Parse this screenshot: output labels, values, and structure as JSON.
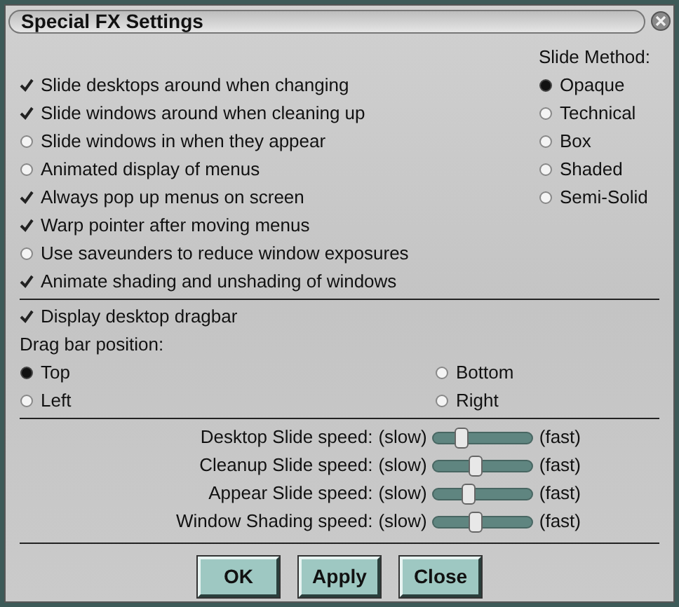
{
  "window": {
    "title": "Special FX Settings"
  },
  "options": [
    {
      "label": "Slide desktops around when changing",
      "checked": true
    },
    {
      "label": "Slide windows around when cleaning up",
      "checked": true
    },
    {
      "label": "Slide windows in when they appear",
      "checked": false
    },
    {
      "label": "Animated display of menus",
      "checked": false
    },
    {
      "label": "Always pop up menus on screen",
      "checked": true
    },
    {
      "label": "Warp pointer after moving menus",
      "checked": true
    },
    {
      "label": "Use saveunders to reduce window exposures",
      "checked": false
    },
    {
      "label": "Animate shading and unshading of windows",
      "checked": true
    }
  ],
  "slide_method": {
    "label": "Slide Method:",
    "choices": [
      {
        "label": "Opaque",
        "selected": true
      },
      {
        "label": "Technical",
        "selected": false
      },
      {
        "label": "Box",
        "selected": false
      },
      {
        "label": "Shaded",
        "selected": false
      },
      {
        "label": "Semi-Solid",
        "selected": false
      }
    ]
  },
  "dragbar": {
    "display": {
      "label": "Display desktop dragbar",
      "checked": true
    },
    "position_label": "Drag bar position:",
    "positions": [
      {
        "label": "Top",
        "selected": true
      },
      {
        "label": "Bottom",
        "selected": false
      },
      {
        "label": "Left",
        "selected": false
      },
      {
        "label": "Right",
        "selected": false
      }
    ]
  },
  "speeds": [
    {
      "label": "Desktop Slide speed:",
      "slow": "(slow)",
      "fast": "(fast)",
      "level": 0.28
    },
    {
      "label": "Cleanup Slide speed:",
      "slow": "(slow)",
      "fast": "(fast)",
      "level": 0.43
    },
    {
      "label": "Appear Slide speed:",
      "slow": "(slow)",
      "fast": "(fast)",
      "level": 0.35
    },
    {
      "label": "Window Shading speed:",
      "slow": "(slow)",
      "fast": "(fast)",
      "level": 0.43
    }
  ],
  "buttons": [
    "OK",
    "Apply",
    "Close"
  ]
}
